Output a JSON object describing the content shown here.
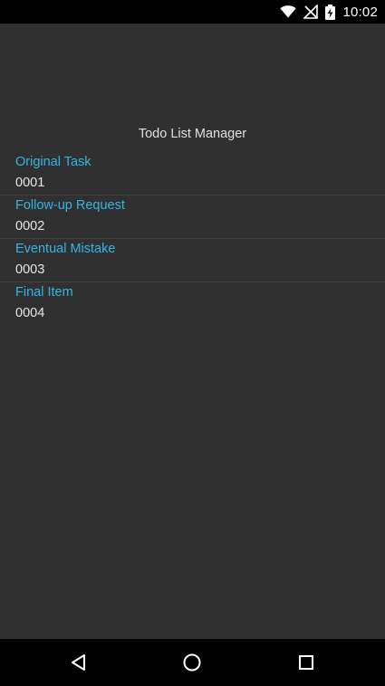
{
  "status_bar": {
    "time": "10:02",
    "icons": [
      "wifi-icon",
      "signal-off-icon",
      "battery-charging-icon"
    ]
  },
  "app": {
    "title": "Todo List Manager",
    "items": [
      {
        "title": "Original Task",
        "id": "0001"
      },
      {
        "title": "Follow-up Request",
        "id": "0002"
      },
      {
        "title": "Eventual Mistake",
        "id": "0003"
      },
      {
        "title": "Final Item",
        "id": "0004"
      }
    ]
  },
  "nav_bar": {
    "icons": [
      "back-icon",
      "home-icon",
      "recents-icon"
    ]
  },
  "colors": {
    "background": "#303030",
    "accent": "#33b5e5",
    "text": "#e6e6e6",
    "bars": "#000000"
  }
}
